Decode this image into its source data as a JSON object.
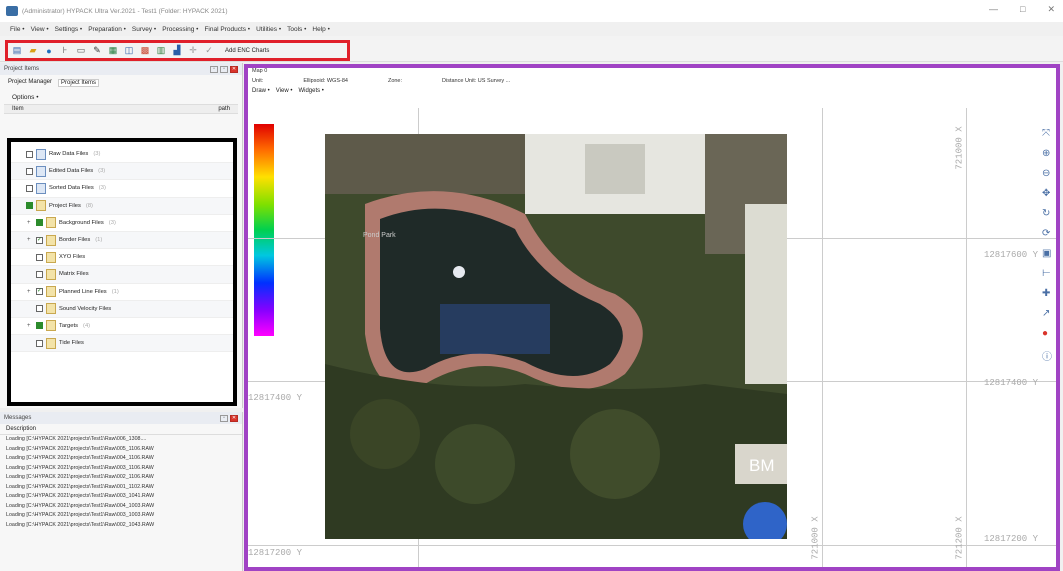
{
  "window": {
    "title": "(Administrator) HYPACK Ultra Ver.2021 - Test1 (Folder: HYPACK 2021)",
    "min": "—",
    "max": "□",
    "close": "✕"
  },
  "menu": [
    "File •",
    "View •",
    "Settings •",
    "Preparation •",
    "Survey •",
    "Processing •",
    "Final Products •",
    "Utilities •",
    "Tools •",
    "Help •"
  ],
  "toolbar": {
    "add_enc": "Add ENC Charts"
  },
  "project_panel": {
    "title": "Project Items",
    "tabs": [
      "Project Manager",
      "Project Items"
    ],
    "options": "Options •",
    "col_item": "Item",
    "col_path": "path"
  },
  "tree": [
    {
      "label": "Raw Data Files",
      "count": "(3)",
      "indent": 0,
      "cb": "",
      "exp": "",
      "folder": false
    },
    {
      "label": "Edited Data Files",
      "count": "(3)",
      "indent": 0,
      "cb": "",
      "exp": "",
      "folder": false
    },
    {
      "label": "Sorted Data Files",
      "count": "(3)",
      "indent": 0,
      "cb": "",
      "exp": "",
      "folder": false
    },
    {
      "label": "Project Files",
      "count": "(8)",
      "indent": 0,
      "cb": "g",
      "exp": "",
      "folder": true
    },
    {
      "label": "Background Files",
      "count": "(3)",
      "indent": 1,
      "cb": "g",
      "exp": "+",
      "folder": true
    },
    {
      "label": "Border Files",
      "count": "(1)",
      "indent": 1,
      "cb": "ck",
      "exp": "+",
      "folder": true
    },
    {
      "label": "XYO Files",
      "count": "",
      "indent": 1,
      "cb": "",
      "exp": "",
      "folder": true
    },
    {
      "label": "Matrix Files",
      "count": "",
      "indent": 1,
      "cb": "",
      "exp": "",
      "folder": true
    },
    {
      "label": "Planned Line Files",
      "count": "(1)",
      "indent": 1,
      "cb": "ck",
      "exp": "+",
      "folder": true
    },
    {
      "label": "Sound Velocity Files",
      "count": "",
      "indent": 1,
      "cb": "",
      "exp": "",
      "folder": true
    },
    {
      "label": "Targets",
      "count": "(4)",
      "indent": 1,
      "cb": "g",
      "exp": "+",
      "folder": true
    },
    {
      "label": "Tide Files",
      "count": "",
      "indent": 1,
      "cb": "",
      "exp": "",
      "folder": true
    }
  ],
  "messages": {
    "title": "Messages",
    "desc": "Description",
    "lines": [
      "Loading [C:\\HYPACK 2021\\projects\\Test1\\Raw\\006_1308....",
      "Loading [C:\\HYPACK 2021\\projects\\Test1\\Raw\\005_1106.RAW",
      "Loading [C:\\HYPACK 2021\\projects\\Test1\\Raw\\004_1106.RAW",
      "Loading [C:\\HYPACK 2021\\projects\\Test1\\Raw\\003_1106.RAW",
      "Loading [C:\\HYPACK 2021\\projects\\Test1\\Raw\\002_1106.RAW",
      "Loading [C:\\HYPACK 2021\\projects\\Test1\\Raw\\001_1102.RAW",
      "Loading [C:\\HYPACK 2021\\projects\\Test1\\Raw\\003_1041.RAW",
      "Loading [C:\\HYPACK 2021\\projects\\Test1\\Raw\\004_1003.RAW",
      "Loading [C:\\HYPACK 2021\\projects\\Test1\\Raw\\003_1003.RAW",
      "Loading [C:\\HYPACK 2021\\projects\\Test1\\Raw\\002_1043.RAW"
    ]
  },
  "map": {
    "tab": "Map 0",
    "unit": "Unit:",
    "ellipsoid": "Ellipsoid: WGS-84",
    "zone": "Zone:",
    "distance": "Distance Unit: US Survey ...",
    "draw": "Draw •",
    "view": "View •",
    "widgets": "Widgets •",
    "y_labels": [
      "12817600 Y",
      "12817600 Y",
      "12817400 Y",
      "12817400 Y",
      "12817200 Y",
      "12817200 Y"
    ],
    "x_labels": [
      "721000 X",
      "721200 X",
      "721000 X",
      "721200 X"
    ],
    "pond_label": "Pond Park",
    "bm_label": "BM"
  }
}
